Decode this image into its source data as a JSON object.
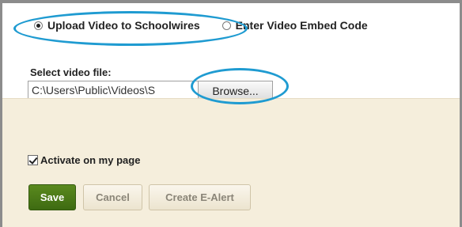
{
  "video_source": {
    "upload_label": "Upload Video to Schoolwires",
    "upload_selected": true,
    "embed_label": "Enter Video Embed Code",
    "embed_selected": false
  },
  "file_select": {
    "label": "Select video file:",
    "value": "C:\\Users\\Public\\Videos\\S",
    "browse_label": "Browse..."
  },
  "options": {
    "activate_label": "Activate on my page",
    "activate_checked": true
  },
  "actions": {
    "save_label": "Save",
    "cancel_label": "Cancel",
    "ealert_label": "Create E-Alert"
  },
  "colors": {
    "highlight": "#1f9bd1",
    "save_green": "#4a7a18",
    "panel_beige": "#f5eedc"
  }
}
